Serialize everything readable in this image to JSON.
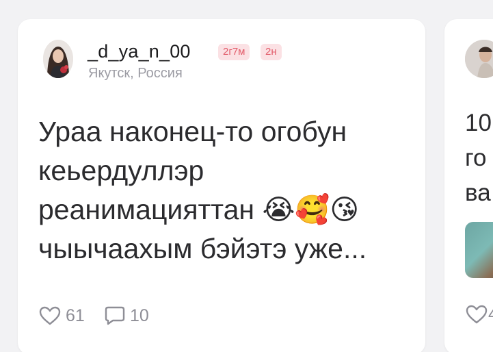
{
  "post": {
    "username": "_d_ya_n_00",
    "age_badge": "2г7м",
    "time_badge": "2н",
    "location": "Якутск, Россия",
    "text": "Ураа наконец-то огобун\nкеьердуллэр\nреанимацияттан 😭🥰😘\nчыычаахым бэйэтэ уже...",
    "likes": "61",
    "comments": "10"
  },
  "next_post": {
    "text": "10\nго\nва",
    "likes": "4"
  },
  "colors": {
    "background": "#f2f2f4",
    "card": "#ffffff",
    "badge_bg": "#fbe1e4",
    "badge_text": "#e25d6b",
    "muted": "#9b9ba3"
  },
  "icons": {
    "like": "heart-outline-icon",
    "comment": "speech-bubble-icon"
  }
}
